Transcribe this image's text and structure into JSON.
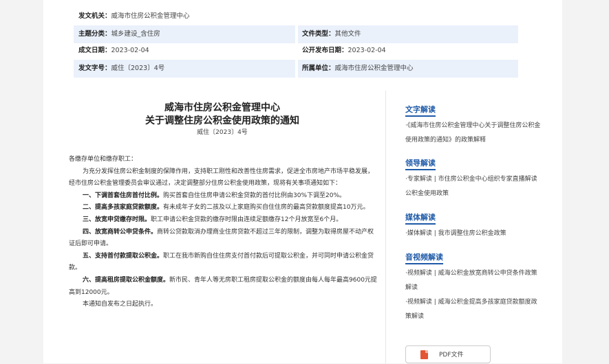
{
  "meta": {
    "issuer": {
      "label": "发文机关：",
      "value": "威海市住房公积金管理中心"
    },
    "subject": {
      "label": "主题分类：",
      "value": "城乡建设_含住房"
    },
    "doc_type": {
      "label": "文件类型：",
      "value": "其他文件"
    },
    "created": {
      "label": "成文日期：",
      "value": "2023-02-04"
    },
    "published": {
      "label": "公开发布日期：",
      "value": "2023-02-04"
    },
    "doc_no": {
      "label": "发文字号：",
      "value": "威住〔2023〕4号"
    },
    "dept": {
      "label": "所属单位：",
      "value": "威海市住房公积金管理中心"
    }
  },
  "doc": {
    "title1": "威海市住房公积金管理中心",
    "title2": "关于调整住房公积金使用政策的通知",
    "number": "威住〔2023〕4号",
    "greeting": "各缴存单位和缴存职工：",
    "intro": "为充分发挥住房公积金制度的保障作用，支持职工刚性和改善性住房需求，促进全市房地产市场平稳发展，经市住房公积金管理委员会审议通过，决定调整部分住房公积金使用政策，现将有关事项通知如下：",
    "items": [
      {
        "head": "一、下调首套住房首付比例。",
        "text": "购买首套自住住房申请公积金贷款的首付比例由30%下调至20%。"
      },
      {
        "head": "二、提高多孩家庭贷款额度。",
        "text": "有未成年子女的二孩及以上家庭购买自住住房的最高贷款额度提高10万元。"
      },
      {
        "head": "三、放宽申贷缴存时限。",
        "text": "职工申请公积金贷款的缴存时限由连续足额缴存12个月放宽至6个月。"
      },
      {
        "head": "四、放宽商转公申贷条件。",
        "text": "商转公贷款取消办理商业住房贷款不超过三年的限制，调整为取得房屋不动产权证后即可申请。"
      },
      {
        "head": "五、支持首付款提取公积金。",
        "text": "职工在我市新购自住住房支付首付款后可提取公积金，并可同时申请公积金贷款。"
      },
      {
        "head": "六、提高租房提取公积金额度。",
        "text": "新市民、青年人等无房职工租房提取公积金的额度由每人每年最高9600元提高到12000元。"
      }
    ],
    "closing": "本通知自发布之日起执行。"
  },
  "sidebar": {
    "sections": [
      {
        "heading": "文字解读",
        "items": [
          "·《威海市住房公积金管理中心关于调整住房公积金使用政策的通知》的政策解释"
        ]
      },
      {
        "heading": "领导解读",
        "items": [
          "·专家解读 | 市住房公积金中心组织专家直播解读公积金使用政策"
        ]
      },
      {
        "heading": "媒体解读",
        "items": [
          "·媒体解读 | 我市调整住房公积金政策"
        ]
      },
      {
        "heading": "音视频解读",
        "items": [
          "·视频解读 | 威海公积金放宽商转公申贷条件政策解读",
          "·视频解读 | 威海公积金提高多孩家庭贷款额度政策解读"
        ]
      }
    ],
    "pdf_label": "PDF文件"
  }
}
